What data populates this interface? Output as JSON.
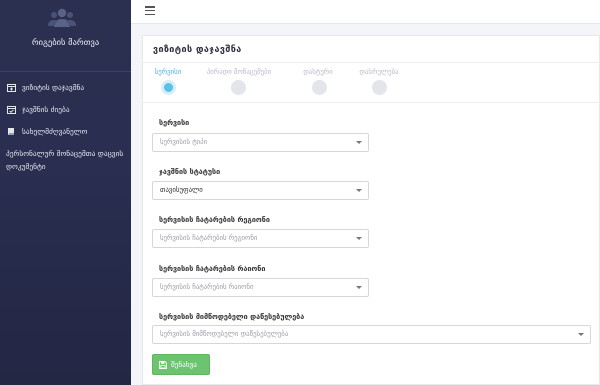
{
  "sidebar": {
    "title": "რიგების მართვა",
    "items": [
      {
        "label": "ვიზიტის დაჯავშნა",
        "icon": "calendar-plus-icon"
      },
      {
        "label": "ჯავშნის ძიება",
        "icon": "calendar-check-icon"
      },
      {
        "label": "სახელმძღვანელო",
        "icon": "book-icon"
      },
      {
        "label": "პერსონალურ მონაცემთა დაცვის დოკუმენტი"
      }
    ]
  },
  "page": {
    "title": "ვიზიტის დაჯავშნა"
  },
  "steps": [
    {
      "label": "სერვისი",
      "active": true
    },
    {
      "label": "პირადი მონაცემები",
      "active": false
    },
    {
      "label": "დასტური",
      "active": false
    },
    {
      "label": "დასრულება",
      "active": false
    }
  ],
  "form": {
    "service": {
      "label": "სერვისი",
      "value": "სერვისის ტიპი"
    },
    "status": {
      "label": "ჯავშნის სტატუსი",
      "value": "თავისუფალი"
    },
    "region": {
      "label": "სერვისის ჩატარების რეგიონი",
      "value": "სერვისის ჩატარების რეგიონი"
    },
    "district": {
      "label": "სერვისის ჩატარების რაიონი",
      "value": "სერვისის ჩატარების რაიონი"
    },
    "institution": {
      "label": "სერვისის მიმწოდებელი დაწესებულება",
      "value": "სერვისის მიმწოდებელი დაწესებულება"
    }
  },
  "buttons": {
    "save": "შენახვა"
  },
  "colors": {
    "sidebar_bg": "#2a2e50",
    "accent": "#5bc0e6",
    "save_green": "#6cc46f"
  }
}
